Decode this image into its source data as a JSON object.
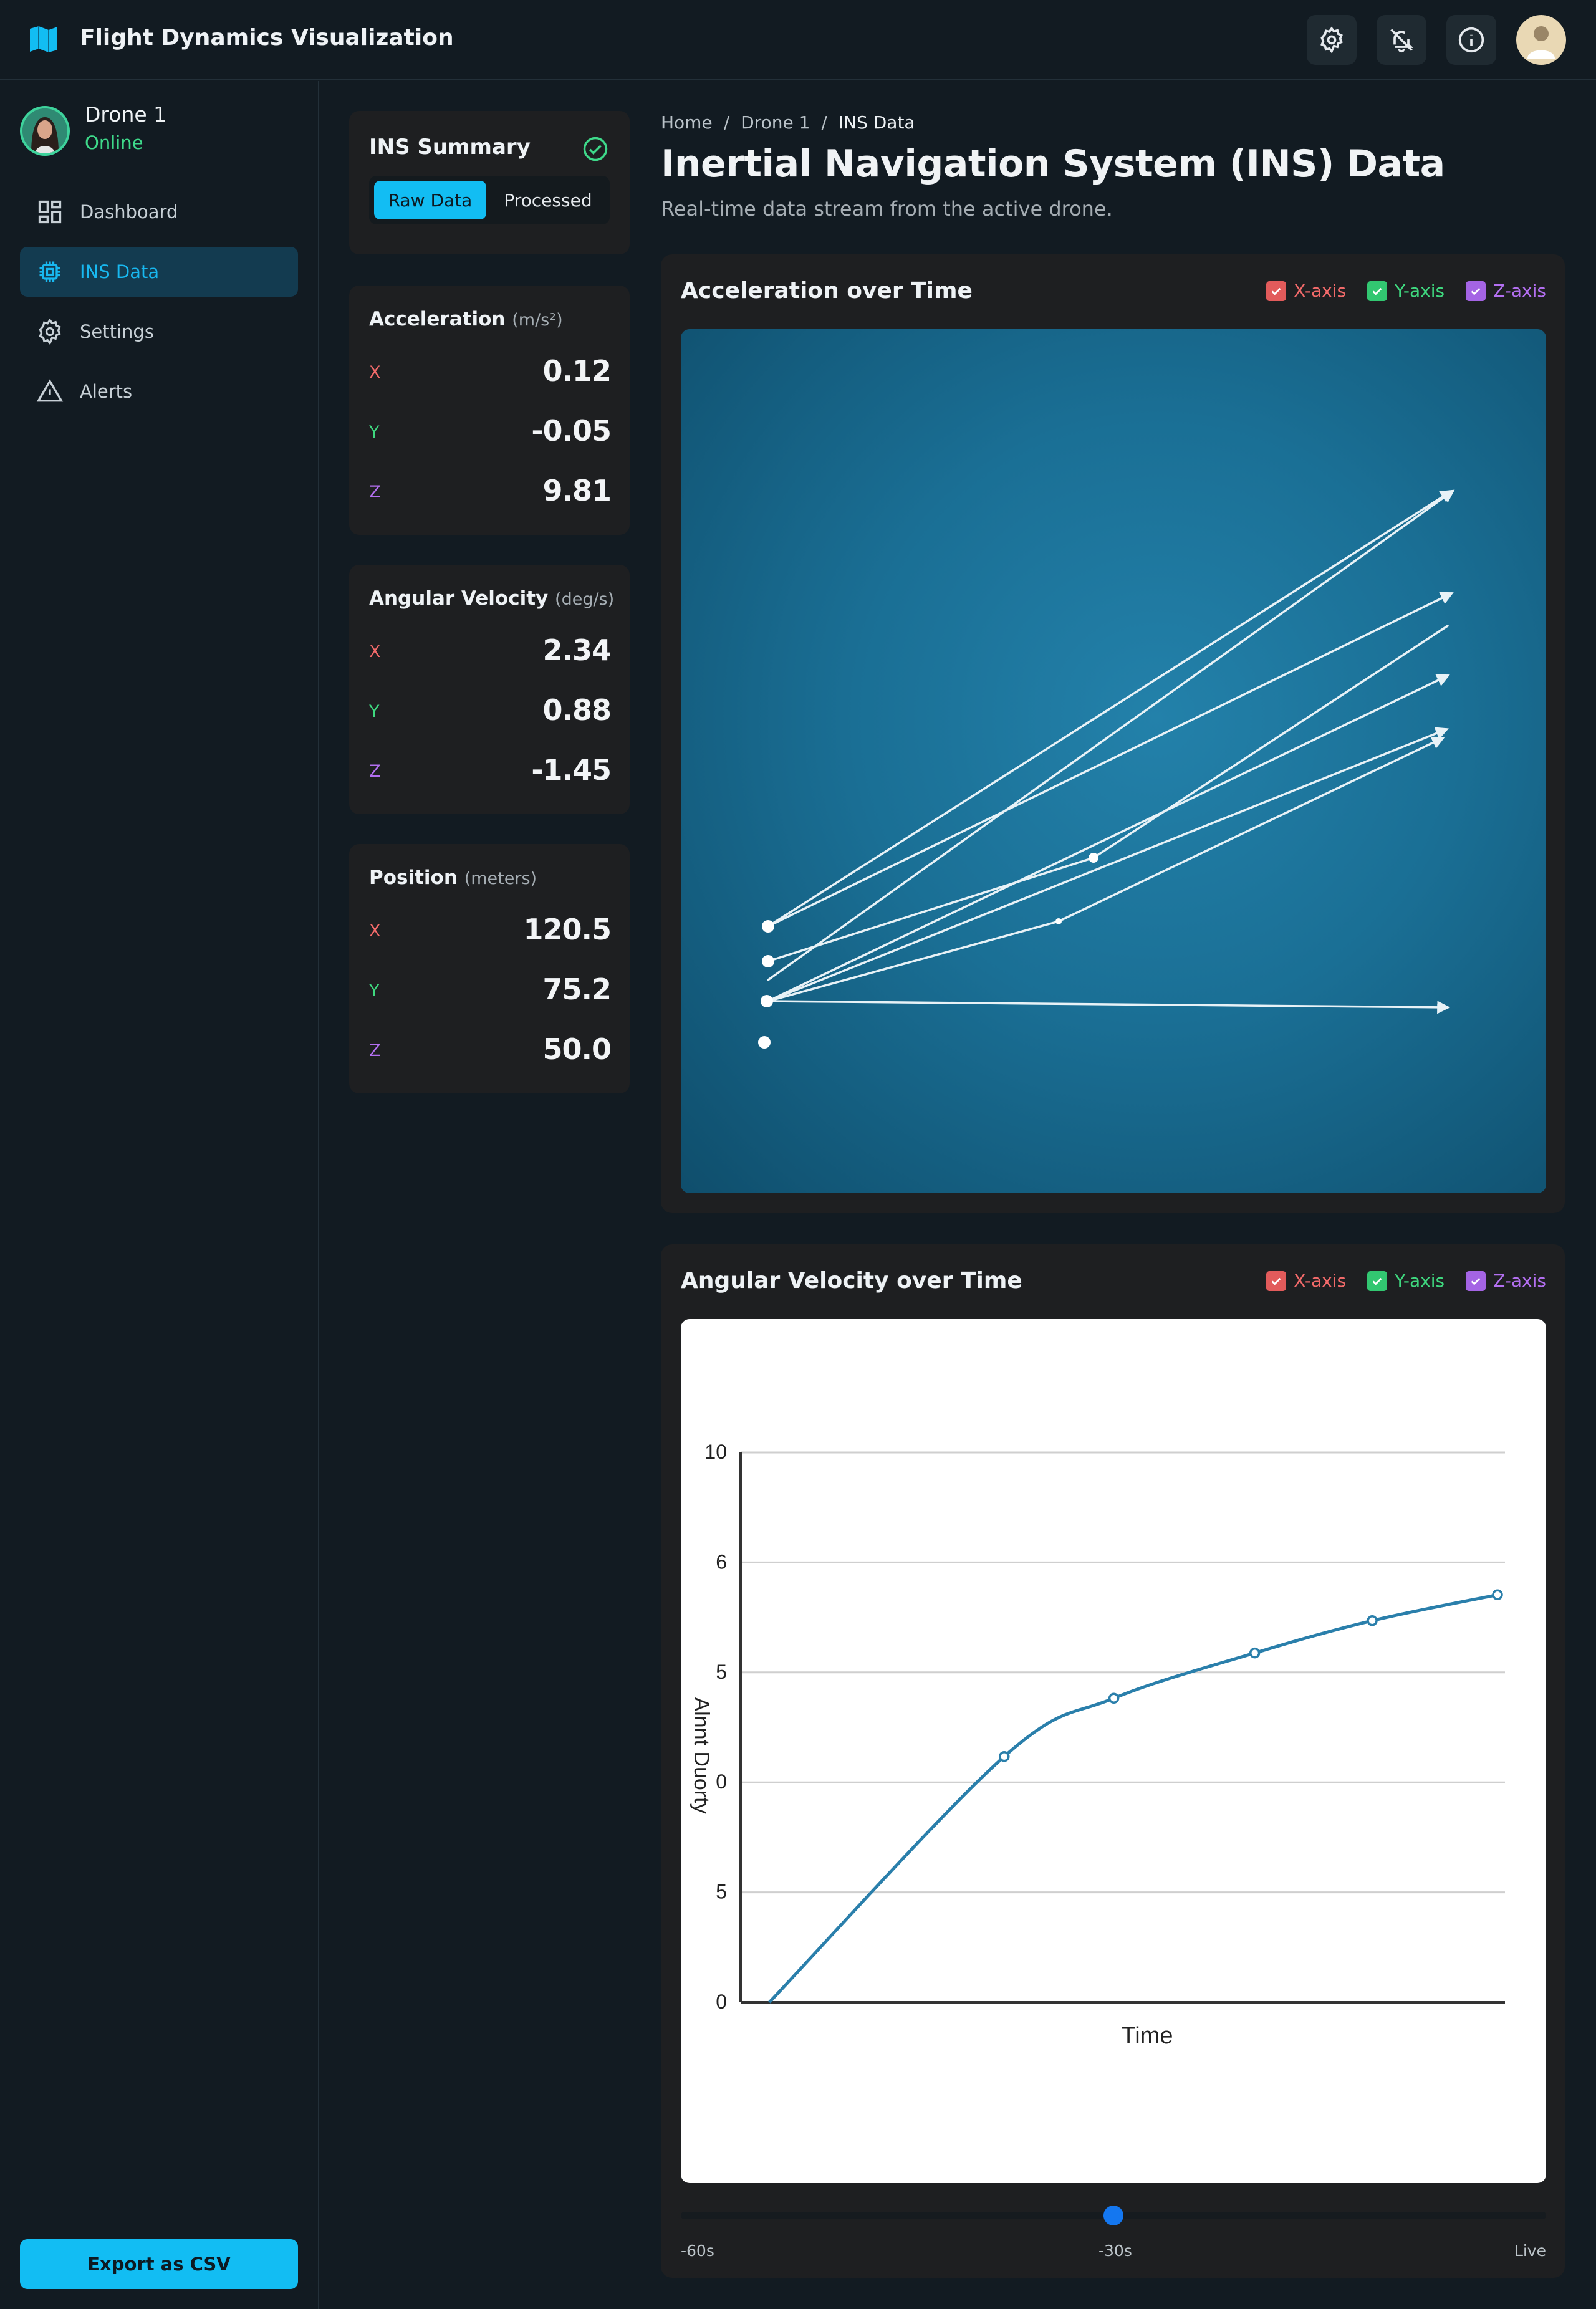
{
  "app": {
    "title": "Flight Dynamics Visualization"
  },
  "topbar": {
    "icons": [
      "settings-icon",
      "notifications-off-icon",
      "info-icon",
      "user-avatar"
    ]
  },
  "sidebar": {
    "drone": {
      "name": "Drone 1",
      "status": "Online"
    },
    "items": [
      {
        "label": "Dashboard",
        "icon": "dashboard-icon",
        "active": false
      },
      {
        "label": "INS Data",
        "icon": "chip-icon",
        "active": true
      },
      {
        "label": "Settings",
        "icon": "gear-icon",
        "active": false
      },
      {
        "label": "Alerts",
        "icon": "warning-icon",
        "active": false
      }
    ],
    "export_label": "Export as CSV"
  },
  "summary": {
    "title": "INS Summary",
    "mode_raw": "Raw Data",
    "mode_processed": "Processed",
    "selected_mode": "Raw Data"
  },
  "acceleration": {
    "title": "Acceleration",
    "unit": "(m/s²)",
    "x_label": "X",
    "x": "0.12",
    "y_label": "Y",
    "y": "-0.05",
    "z_label": "Z",
    "z": "9.81"
  },
  "angular_velocity": {
    "title": "Angular Velocity",
    "unit": "(deg/s)",
    "x_label": "X",
    "x": "2.34",
    "y_label": "Y",
    "y": "0.88",
    "z_label": "Z",
    "z": "-1.45"
  },
  "position": {
    "title": "Position",
    "unit": "(meters)",
    "x_label": "X",
    "x": "120.5",
    "y_label": "Y",
    "y": "75.2",
    "z_label": "Z",
    "z": "50.0"
  },
  "breadcrumb": {
    "home": "Home",
    "drone": "Drone 1",
    "current": "INS Data",
    "sep": "/"
  },
  "main": {
    "title": "Inertial Navigation System (INS) Data",
    "subtitle": "Real-time data stream from the active drone."
  },
  "legend": {
    "x": "X-axis",
    "y": "Y-axis",
    "z": "Z-axis",
    "x_checked": true,
    "y_checked": true,
    "z_checked": true
  },
  "colors": {
    "accent": "#12bdf3",
    "x_axis": "#f26a6a",
    "y_axis": "#3fd87f",
    "z_axis": "#b36ff0",
    "online": "#3ed98a"
  },
  "panels": {
    "acceleration_title": "Acceleration over Time",
    "angular_title": "Angular Velocity over Time"
  },
  "chart_data": {
    "type": "line",
    "title": "",
    "xlabel": "Time",
    "ylabel": "Alnnt Duorty",
    "y_tick_labels": [
      "0",
      "5",
      "0",
      "5",
      "6",
      "10"
    ],
    "series": [
      {
        "x": [
          0,
          0.3,
          0.44,
          0.62,
          0.77,
          0.93
        ],
        "values": [
          0.0,
          3.8,
          4.7,
          5.4,
          5.9,
          6.3
        ]
      }
    ]
  },
  "timeline": {
    "start_label": "-60s",
    "mid_label": "-30s",
    "end_label": "Live",
    "value_fraction": 0.5
  }
}
